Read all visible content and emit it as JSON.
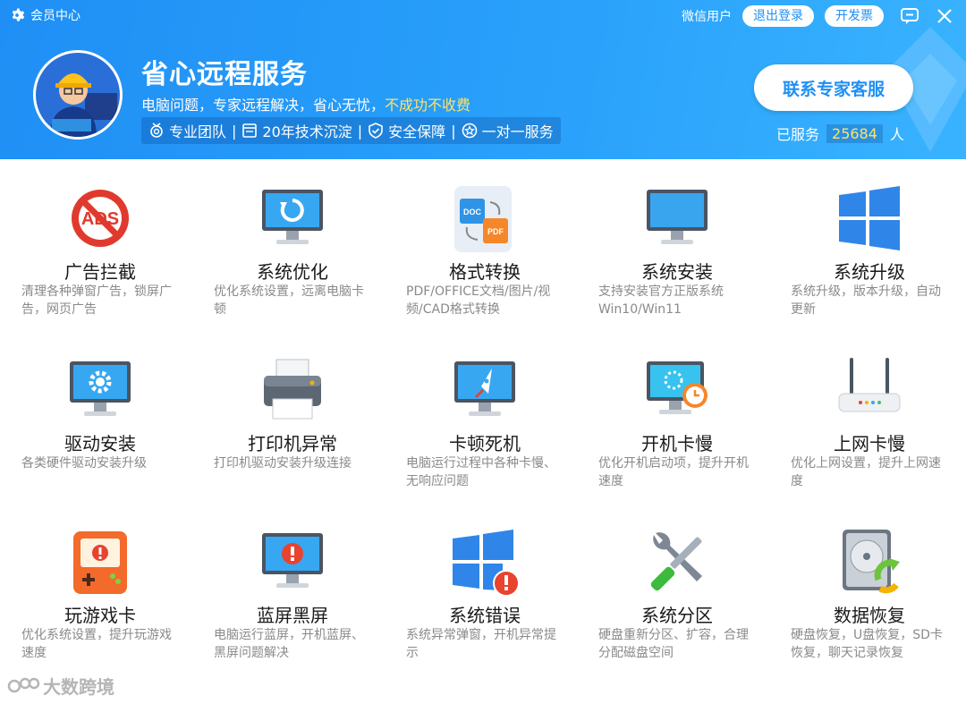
{
  "header": {
    "member_center": "会员中心",
    "wechat_user": "微信用户",
    "logout": "退出登录",
    "invoice": "开发票",
    "title": "省心远程服务",
    "subtitle_main": "电脑问题，专家远程解决，省心无忧，",
    "subtitle_highlight": "不成功不收费",
    "features": [
      "专业团队",
      "20年技术沉淀",
      "安全保障",
      "一对一服务"
    ],
    "contact_button": "联系专家客服",
    "served_prefix": "已服务",
    "served_count": "25684",
    "served_suffix": "人"
  },
  "services": [
    {
      "name": "广告拦截",
      "desc": "清理各种弹窗广告，锁屏广告，网页广告",
      "icon": "ads-block-icon"
    },
    {
      "name": "系统优化",
      "desc": "优化系统设置，远离电脑卡顿",
      "icon": "monitor-refresh-icon"
    },
    {
      "name": "格式转换",
      "desc": "PDF/OFFICE文档/图片/视频/CAD格式转换",
      "icon": "doc-pdf-convert-icon"
    },
    {
      "name": "系统安装",
      "desc": "支持安装官方正版系统Win10/Win11",
      "icon": "monitor-icon"
    },
    {
      "name": "系统升级",
      "desc": "系统升级，版本升级，自动更新",
      "icon": "windows-logo-icon"
    },
    {
      "name": "驱动安装",
      "desc": "各类硬件驱动安装升级",
      "icon": "monitor-gear-icon"
    },
    {
      "name": "打印机异常",
      "desc": "打印机驱动安装升级连接",
      "icon": "printer-icon"
    },
    {
      "name": "卡顿死机",
      "desc": "电脑运行过程中各种卡慢、无响应问题",
      "icon": "monitor-rocket-icon"
    },
    {
      "name": "开机卡慢",
      "desc": "优化开机启动项，提升开机速度",
      "icon": "monitor-clock-icon"
    },
    {
      "name": "上网卡慢",
      "desc": "优化上网设置，提升上网速度",
      "icon": "router-icon"
    },
    {
      "name": "玩游戏卡",
      "desc": "优化系统设置，提升玩游戏速度",
      "icon": "game-console-icon"
    },
    {
      "name": "蓝屏黑屏",
      "desc": "电脑运行蓝屏，开机蓝屏、黑屏问题解决",
      "icon": "monitor-alert-icon"
    },
    {
      "name": "系统错误",
      "desc": "系统异常弹窗，开机异常提示",
      "icon": "windows-error-icon"
    },
    {
      "name": "系统分区",
      "desc": "硬盘重新分区、扩容，合理分配磁盘空间",
      "icon": "tools-icon"
    },
    {
      "name": "数据恢复",
      "desc": "硬盘恢复，U盘恢复，SD卡恢复，聊天记录恢复",
      "icon": "hdd-recover-icon"
    }
  ],
  "watermark": "大数跨境",
  "colors": {
    "header_blue": "#1f8ff5",
    "highlight_yellow": "#ffe36b"
  }
}
